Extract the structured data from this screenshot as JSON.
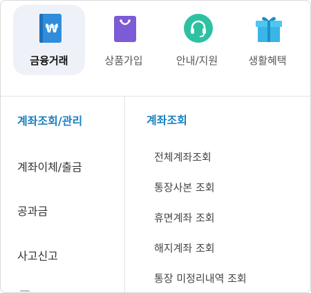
{
  "tabs": [
    {
      "label": "금융거래",
      "icon": "won-card-icon",
      "active": true
    },
    {
      "label": "상품가입",
      "icon": "shopping-bag-icon",
      "active": false
    },
    {
      "label": "안내/지원",
      "icon": "headset-icon",
      "active": false
    },
    {
      "label": "생활혜택",
      "icon": "gift-icon",
      "active": false
    }
  ],
  "colors": {
    "accent": "#1a7fc2",
    "won_card": "#2f8ddb",
    "bag": "#7d5bd6",
    "headset": "#2dc1a2",
    "gift": "#39b5e6"
  },
  "left_menu": {
    "items": [
      "계좌조회/관리",
      "계좌이체/출금",
      "공과금",
      "사고신고"
    ],
    "active_index": 0
  },
  "right_menu": {
    "title": "계좌조회",
    "items": [
      "전체계좌조회",
      "통장사본 조회",
      "휴면계좌 조회",
      "해지계좌 조회",
      "통장 미정리내역 조회"
    ]
  }
}
